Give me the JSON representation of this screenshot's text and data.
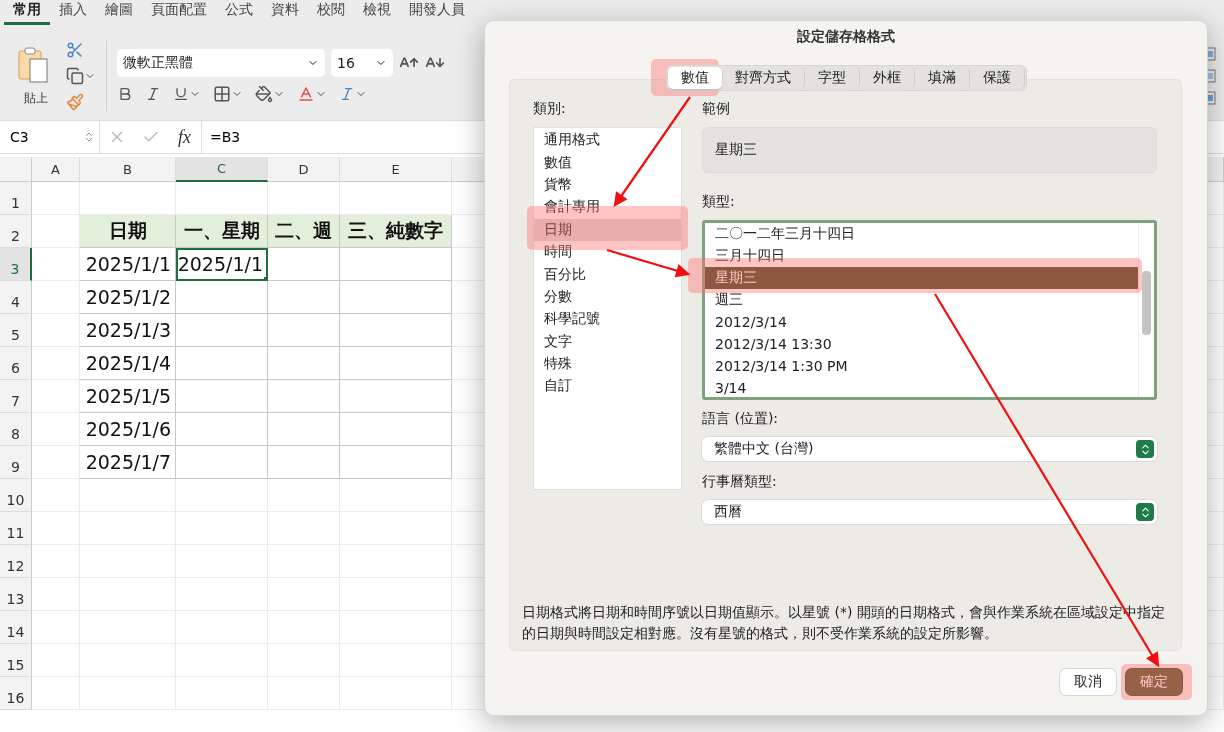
{
  "ribbon_tabs": [
    {
      "label": "常用",
      "selected": true
    },
    {
      "label": "插入",
      "selected": false
    },
    {
      "label": "繪圖",
      "selected": false
    },
    {
      "label": "頁面配置",
      "selected": false
    },
    {
      "label": "公式",
      "selected": false
    },
    {
      "label": "資料",
      "selected": false
    },
    {
      "label": "校閱",
      "selected": false
    },
    {
      "label": "檢視",
      "selected": false
    },
    {
      "label": "開發人員",
      "selected": false
    }
  ],
  "ribbon": {
    "paste_label": "貼上",
    "font_name": "微軟正黑體",
    "font_size": "16"
  },
  "formula_bar": {
    "cell_ref": "C3",
    "function_label": "fx",
    "formula": "=B3"
  },
  "columns": [
    {
      "label": "A",
      "selected": false
    },
    {
      "label": "B",
      "selected": false
    },
    {
      "label": "C",
      "selected": true
    },
    {
      "label": "D",
      "selected": false
    },
    {
      "label": "E",
      "selected": false
    }
  ],
  "row_numbers": [
    {
      "label": "1",
      "selected": false
    },
    {
      "label": "2",
      "selected": false
    },
    {
      "label": "3",
      "selected": true
    },
    {
      "label": "4",
      "selected": false
    },
    {
      "label": "5",
      "selected": false
    },
    {
      "label": "6",
      "selected": false
    },
    {
      "label": "7",
      "selected": false
    },
    {
      "label": "8",
      "selected": false
    },
    {
      "label": "9",
      "selected": false
    },
    {
      "label": "10",
      "selected": false
    },
    {
      "label": "11",
      "selected": false
    },
    {
      "label": "12",
      "selected": false
    },
    {
      "label": "13",
      "selected": false
    },
    {
      "label": "14",
      "selected": false
    },
    {
      "label": "15",
      "selected": false
    },
    {
      "label": "16",
      "selected": false
    }
  ],
  "sheet": {
    "header": [
      "日期",
      "一、星期",
      "二、週",
      "三、純數字"
    ],
    "rows": [
      {
        "cells": [
          {
            "text": "2025/1/1",
            "selected": false
          },
          {
            "text": "2025/1/1",
            "selected": true
          }
        ]
      },
      {
        "cells": [
          {
            "text": "2025/1/2",
            "selected": false
          }
        ]
      },
      {
        "cells": [
          {
            "text": "2025/1/3",
            "selected": false
          }
        ]
      },
      {
        "cells": [
          {
            "text": "2025/1/4",
            "selected": false
          }
        ]
      },
      {
        "cells": [
          {
            "text": "2025/1/5",
            "selected": false
          }
        ]
      },
      {
        "cells": [
          {
            "text": "2025/1/6",
            "selected": false
          }
        ]
      },
      {
        "cells": [
          {
            "text": "2025/1/7",
            "selected": false
          }
        ]
      }
    ]
  },
  "dialog": {
    "title": "設定儲存格格式",
    "tabs": [
      {
        "label": "數值",
        "selected": true
      },
      {
        "label": "對齊方式",
        "selected": false
      },
      {
        "label": "字型",
        "selected": false
      },
      {
        "label": "外框",
        "selected": false
      },
      {
        "label": "填滿",
        "selected": false
      },
      {
        "label": "保護",
        "selected": false
      }
    ],
    "category_label": "類別:",
    "categories": [
      {
        "label": "通用格式",
        "selected": false
      },
      {
        "label": "數值",
        "selected": false
      },
      {
        "label": "貨幣",
        "selected": false
      },
      {
        "label": "會計專用",
        "selected": false
      },
      {
        "label": "日期",
        "selected": true
      },
      {
        "label": "時間",
        "selected": false
      },
      {
        "label": "百分比",
        "selected": false
      },
      {
        "label": "分數",
        "selected": false
      },
      {
        "label": "科學記號",
        "selected": false
      },
      {
        "label": "文字",
        "selected": false
      },
      {
        "label": "特殊",
        "selected": false
      },
      {
        "label": "自訂",
        "selected": false
      }
    ],
    "sample_label": "範例",
    "sample": "星期三",
    "type_label": "類型:",
    "types": [
      {
        "label": "二〇一二年三月十四日",
        "selected": false
      },
      {
        "label": "三月十四日",
        "selected": false
      },
      {
        "label": "星期三",
        "selected": true
      },
      {
        "label": "週三",
        "selected": false
      },
      {
        "label": "2012/3/14",
        "selected": false
      },
      {
        "label": "2012/3/14 13:30",
        "selected": false
      },
      {
        "label": "2012/3/14 1:30 PM",
        "selected": false
      },
      {
        "label": "3/14",
        "selected": false
      }
    ],
    "language_label": "語言 (位置):",
    "language": "繁體中文 (台灣)",
    "calendar_label": "行事曆類型:",
    "calendar": "西曆",
    "description": "日期格式將日期和時間序號以日期值顯示。以星號 (*) 開頭的日期格式，會與作業系統在區域設定中指定的日期與時間設定相對應。沒有星號的格式，則不受作業系統的設定所影響。",
    "buttons": [
      {
        "label": "取消",
        "kind": "secondary"
      },
      {
        "label": "確定",
        "kind": "primary"
      }
    ]
  }
}
